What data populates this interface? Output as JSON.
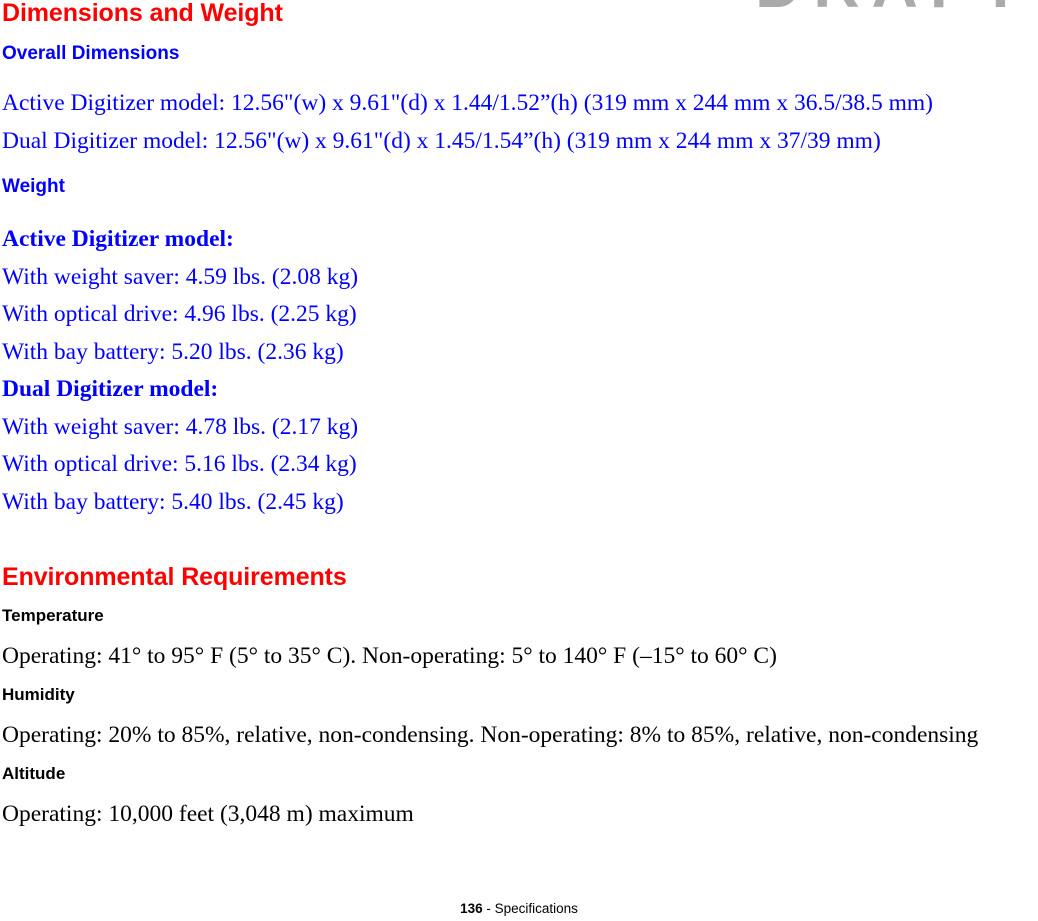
{
  "watermark": {
    "text": "DRAFT"
  },
  "sections": [
    {
      "title": "Dimensions and Weight",
      "subsections": [
        {
          "heading": "Overall Dimensions",
          "lines": [
            "Active Digitizer model: 12.56\"(w) x 9.61\"(d) x 1.44/1.52”(h) (319 mm x 244 mm x 36.5/38.5 mm)",
            "Dual Digitizer model: 12.56\"(w) x 9.61\"(d) x 1.45/1.54”(h) (319 mm x 244 mm x 37/39 mm)"
          ]
        },
        {
          "heading": "Weight",
          "groups": [
            {
              "label": "Active Digitizer model:",
              "lines": [
                "With weight saver: 4.59 lbs. (2.08 kg)",
                "With optical drive: 4.96 lbs. (2.25 kg)",
                "With bay battery: 5.20 lbs. (2.36 kg)"
              ]
            },
            {
              "label": "Dual Digitizer model:",
              "lines": [
                "With weight saver: 4.78 lbs. (2.17 kg)",
                "With optical drive: 5.16 lbs. (2.34 kg)",
                "With bay battery: 5.40 lbs. (2.45 kg)"
              ]
            }
          ]
        }
      ]
    },
    {
      "title": "Environmental Requirements",
      "items": [
        {
          "heading": "Temperature",
          "body": "Operating: 41° to 95° F (5° to 35° C). Non-operating: 5° to 140° F (–15° to 60° C)"
        },
        {
          "heading": "Humidity",
          "body": "Operating: 20% to 85%, relative, non-condensing. Non-operating: 8% to 85%, relative, non-condensing"
        },
        {
          "heading": "Altitude",
          "body": "Operating: 10,000 feet (3,048 m) maximum"
        }
      ]
    }
  ],
  "footer": {
    "page_number": "136",
    "separator": " - ",
    "label": "Specifications"
  }
}
